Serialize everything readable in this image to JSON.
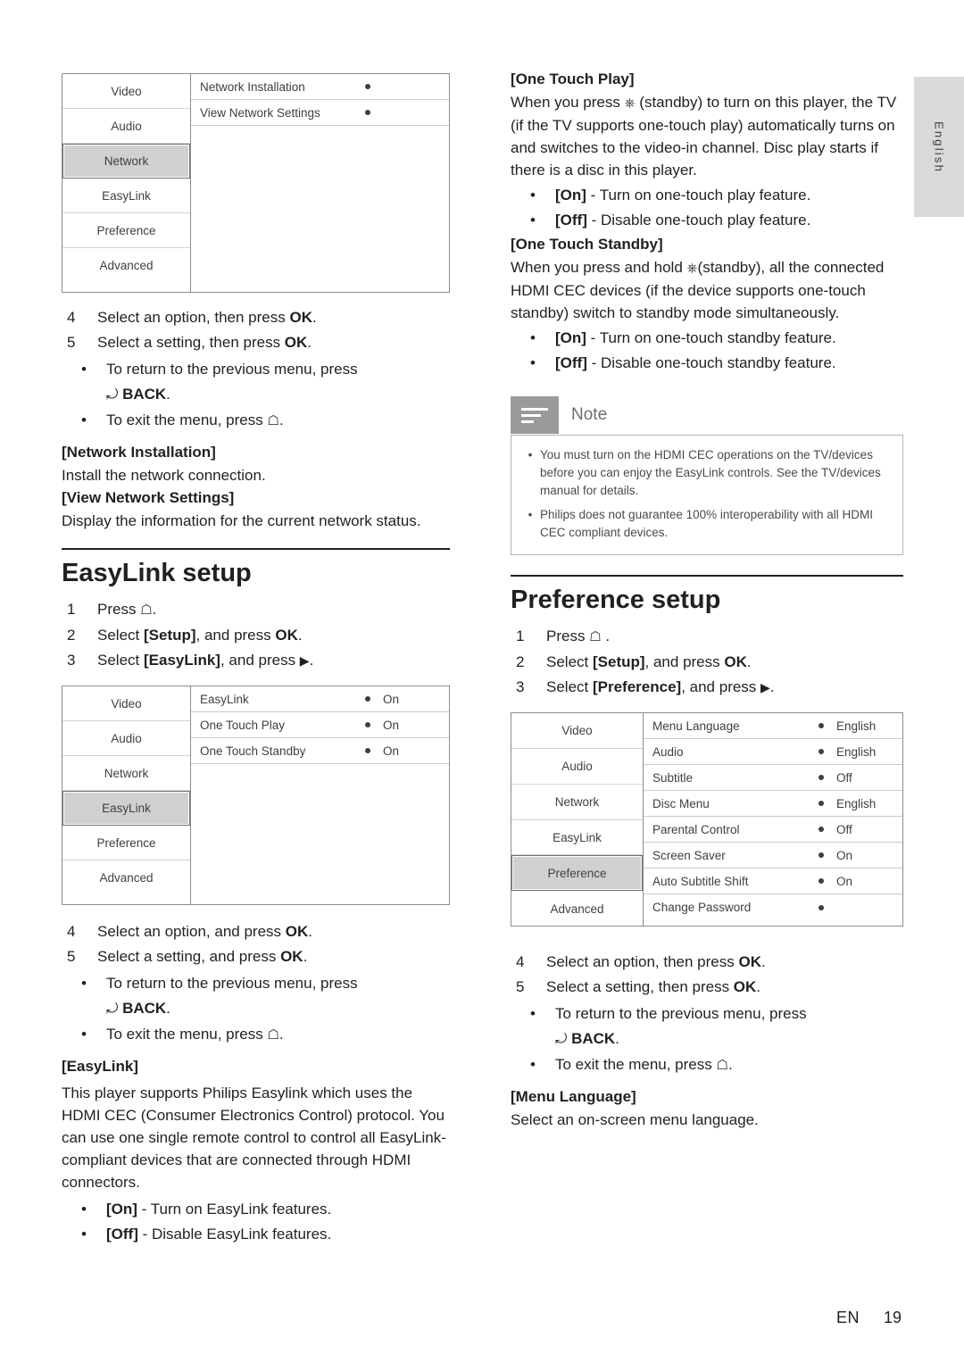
{
  "side_tab": {
    "label": "English"
  },
  "left": {
    "screenshot1": {
      "menu_items": [
        "Video",
        "Audio",
        "Network",
        "EasyLink",
        "Preference",
        "Advanced"
      ],
      "selected": "Network",
      "rows": [
        {
          "label": "Network Installation",
          "value": ""
        },
        {
          "label": "View Network Settings",
          "value": ""
        }
      ]
    },
    "steps1": [
      {
        "num": "4",
        "text": "Select an option, then press OK."
      },
      {
        "num": "5",
        "text": "Select a setting, then press OK."
      }
    ],
    "bullets1": [
      "To return to the previous menu, press",
      "To exit the menu, press"
    ],
    "back_label": "BACK",
    "net_install_head": "[Network Installation]",
    "net_install_text": "Install the network connection.",
    "view_net_head": "[View Network Settings]",
    "view_net_text": "Display the information for the current network status.",
    "easylink_title": "EasyLink setup",
    "steps2": [
      {
        "num": "1",
        "text": "Press"
      },
      {
        "num": "2",
        "text": "Select [Setup], and press OK."
      },
      {
        "num": "3",
        "text": "Select [EasyLink], and press"
      }
    ],
    "screenshot2": {
      "menu_items": [
        "Video",
        "Audio",
        "Network",
        "EasyLink",
        "Preference",
        "Advanced"
      ],
      "selected": "EasyLink",
      "rows": [
        {
          "label": "EasyLink",
          "value": "On"
        },
        {
          "label": "One Touch Play",
          "value": "On"
        },
        {
          "label": "One Touch Standby",
          "value": "On"
        }
      ]
    },
    "steps3": [
      {
        "num": "4",
        "text": "Select an option, and press OK."
      },
      {
        "num": "5",
        "text": "Select a setting, and press OK."
      }
    ],
    "easylink_head": "[EasyLink]",
    "easylink_para": "This player supports Philips Easylink which uses the HDMI CEC (Consumer Electronics Control) protocol. You can use one single remote control to control all EasyLink-compliant devices that are connected through HDMI connectors.",
    "easylink_opts": [
      {
        "key": "[On]",
        "desc": " - Turn on EasyLink features."
      },
      {
        "key": "[Off]",
        "desc": " - Disable EasyLink features."
      }
    ]
  },
  "right": {
    "one_touch_play_head": "[One Touch Play]",
    "one_touch_play_para_a": "When you press ",
    "one_touch_play_para_b": " (standby) to turn on this player, the TV (if the TV supports one-touch play) automatically turns on and switches to the video-in channel. Disc play starts if there is a disc in this player.",
    "one_touch_play_opts": [
      {
        "key": "[On]",
        "desc": " - Turn on one-touch play feature."
      },
      {
        "key": "[Off]",
        "desc": " - Disable one-touch play feature."
      }
    ],
    "one_touch_standby_head": "[One Touch Standby]",
    "one_touch_standby_para_a": "When you press and hold ",
    "one_touch_standby_para_b": "(standby), all the connected HDMI CEC devices (if the device supports one-touch standby) switch to standby mode simultaneously.",
    "one_touch_standby_opts": [
      {
        "key": "[On]",
        "desc": " - Turn on one-touch standby feature."
      },
      {
        "key": "[Off]",
        "desc": " - Disable one-touch standby feature."
      }
    ],
    "note": {
      "title": "Note",
      "items": [
        "You must turn on the HDMI CEC operations on the TV/devices before you can enjoy the EasyLink controls. See the TV/devices manual for details.",
        "Philips does not guarantee 100% interoperability with all HDMI CEC compliant devices."
      ]
    },
    "preference_title": "Preference setup",
    "steps1": [
      {
        "num": "1",
        "text": "Press"
      },
      {
        "num": "2",
        "text": "Select [Setup], and press OK."
      },
      {
        "num": "3",
        "text": "Select [Preference], and press"
      }
    ],
    "screenshot": {
      "menu_items": [
        "Video",
        "Audio",
        "Network",
        "EasyLink",
        "Preference",
        "Advanced"
      ],
      "selected": "Preference",
      "rows": [
        {
          "label": "Menu Language",
          "value": "English"
        },
        {
          "label": "Audio",
          "value": "English"
        },
        {
          "label": "Subtitle",
          "value": "Off"
        },
        {
          "label": "Disc Menu",
          "value": "English"
        },
        {
          "label": "Parental Control",
          "value": "Off"
        },
        {
          "label": "Screen Saver",
          "value": "On"
        },
        {
          "label": "Auto Subtitle Shift",
          "value": "On"
        },
        {
          "label": "Change Password",
          "value": ""
        }
      ]
    },
    "steps2": [
      {
        "num": "4",
        "text": "Select an option, then press OK."
      },
      {
        "num": "5",
        "text": "Select a setting, then press OK."
      }
    ],
    "bullets": [
      "To return to the previous menu, press",
      "To exit the menu, press"
    ],
    "back_label": "BACK",
    "menu_lang_head": "[Menu Language]",
    "menu_lang_text": "Select an on-screen menu language."
  },
  "footer": {
    "en": "EN",
    "page": "19"
  },
  "icons": {
    "home": "⌂",
    "standby": "⏻",
    "back_arrow": "↶",
    "right_arrow": "▶"
  }
}
